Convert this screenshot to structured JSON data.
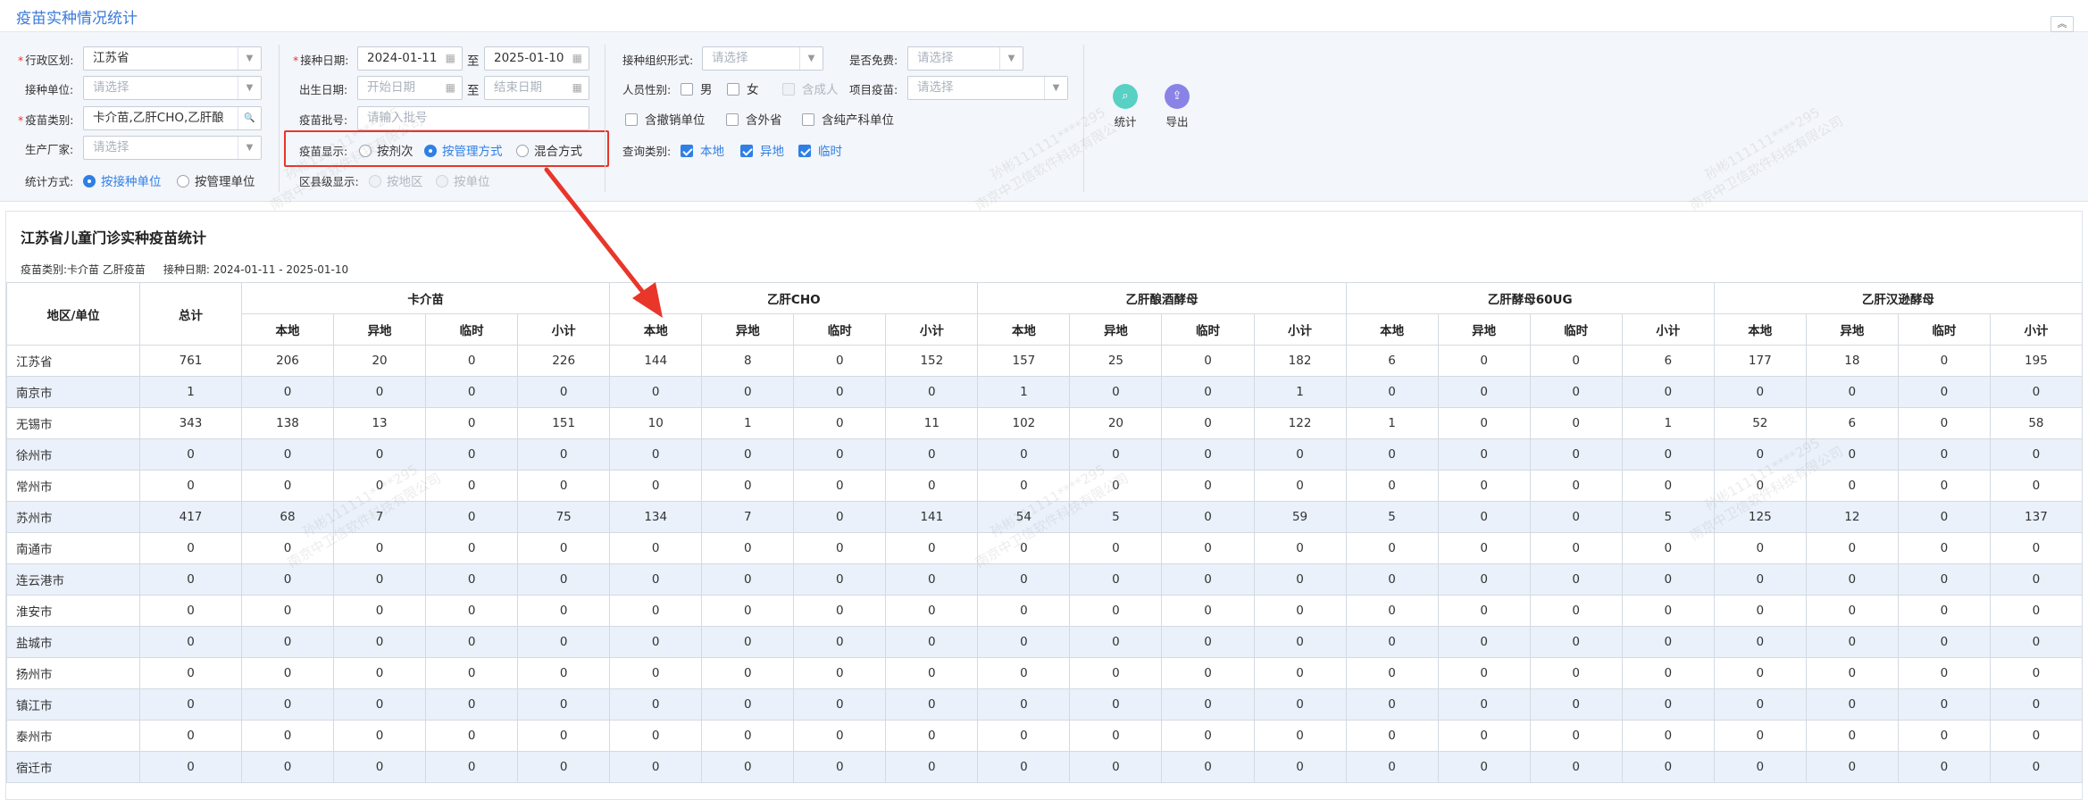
{
  "page": {
    "title": "疫苗实种情况统计",
    "collapse_icon": "double-chevron-up-icon"
  },
  "filters": {
    "region_label": "行政区划:",
    "region_value": "江苏省",
    "unit_label": "接种单位:",
    "unit_placeholder": "请选择",
    "vaccine_type_label": "疫苗类别:",
    "vaccine_type_value": "卡介苗,乙肝CHO,乙肝酿",
    "manufacturer_label": "生产厂家:",
    "manufacturer_placeholder": "请选择",
    "stat_method_label": "统计方式:",
    "stat_method_options": [
      "按接种单位",
      "按管理单位"
    ],
    "vacc_date_label": "接种日期:",
    "vacc_date_from": "2024-01-11",
    "vacc_date_to": "2025-01-10",
    "range_sep": "至",
    "birth_date_label": "出生日期:",
    "birth_date_from_placeholder": "开始日期",
    "birth_date_to_placeholder": "结束日期",
    "batch_label": "疫苗批号:",
    "batch_placeholder": "请输入批号",
    "display_label": "疫苗显示:",
    "display_options": [
      "按剂次",
      "按管理方式",
      "混合方式"
    ],
    "county_label": "区县级显示:",
    "county_options": [
      "按地区",
      "按单位"
    ],
    "org_form_label": "接种组织形式:",
    "org_form_placeholder": "请选择",
    "gender_label": "人员性别:",
    "gender_options": [
      "男",
      "女"
    ],
    "adult_label": "含成人",
    "free_label": "是否免费:",
    "free_placeholder": "请选择",
    "project_label": "项目疫苗:",
    "project_placeholder": "请选择",
    "include_options": [
      "含撤销单位",
      "含外省",
      "含纯产科单位"
    ],
    "query_type_label": "查询类别:",
    "query_type_options": [
      "本地",
      "异地",
      "临时"
    ],
    "stat_button": "统计",
    "export_button": "导出"
  },
  "report": {
    "title": "江苏省儿童门诊实种疫苗统计",
    "sub_vaccine": "疫苗类别:卡介苗 乙肝疫苗",
    "sub_date": "接种日期: 2024-01-11 - 2025-01-10",
    "col_region": "地区/单位",
    "col_total": "总计",
    "vaccines": [
      "卡介苗",
      "乙肝CHO",
      "乙肝酿酒酵母",
      "乙肝酵母60UG",
      "乙肝汉逊酵母"
    ],
    "sub_cols": [
      "本地",
      "异地",
      "临时",
      "小计"
    ],
    "rows": [
      {
        "region": "江苏省",
        "cells": [
          "761",
          "206",
          "20",
          "0",
          "226",
          "144",
          "8",
          "0",
          "152",
          "157",
          "25",
          "0",
          "182",
          "6",
          "0",
          "0",
          "6",
          "177",
          "18",
          "0",
          "195"
        ]
      },
      {
        "region": "南京市",
        "cells": [
          "1",
          "0",
          "0",
          "0",
          "0",
          "0",
          "0",
          "0",
          "0",
          "1",
          "0",
          "0",
          "1",
          "0",
          "0",
          "0",
          "0",
          "0",
          "0",
          "0",
          "0"
        ]
      },
      {
        "region": "无锡市",
        "cells": [
          "343",
          "138",
          "13",
          "0",
          "151",
          "10",
          "1",
          "0",
          "11",
          "102",
          "20",
          "0",
          "122",
          "1",
          "0",
          "0",
          "1",
          "52",
          "6",
          "0",
          "58"
        ]
      },
      {
        "region": "徐州市",
        "cells": [
          "0",
          "0",
          "0",
          "0",
          "0",
          "0",
          "0",
          "0",
          "0",
          "0",
          "0",
          "0",
          "0",
          "0",
          "0",
          "0",
          "0",
          "0",
          "0",
          "0",
          "0"
        ]
      },
      {
        "region": "常州市",
        "cells": [
          "0",
          "0",
          "0",
          "0",
          "0",
          "0",
          "0",
          "0",
          "0",
          "0",
          "0",
          "0",
          "0",
          "0",
          "0",
          "0",
          "0",
          "0",
          "0",
          "0",
          "0"
        ]
      },
      {
        "region": "苏州市",
        "cells": [
          "417",
          "68",
          "7",
          "0",
          "75",
          "134",
          "7",
          "0",
          "141",
          "54",
          "5",
          "0",
          "59",
          "5",
          "0",
          "0",
          "5",
          "125",
          "12",
          "0",
          "137"
        ]
      },
      {
        "region": "南通市",
        "cells": [
          "0",
          "0",
          "0",
          "0",
          "0",
          "0",
          "0",
          "0",
          "0",
          "0",
          "0",
          "0",
          "0",
          "0",
          "0",
          "0",
          "0",
          "0",
          "0",
          "0",
          "0"
        ]
      },
      {
        "region": "连云港市",
        "cells": [
          "0",
          "0",
          "0",
          "0",
          "0",
          "0",
          "0",
          "0",
          "0",
          "0",
          "0",
          "0",
          "0",
          "0",
          "0",
          "0",
          "0",
          "0",
          "0",
          "0",
          "0"
        ]
      },
      {
        "region": "淮安市",
        "cells": [
          "0",
          "0",
          "0",
          "0",
          "0",
          "0",
          "0",
          "0",
          "0",
          "0",
          "0",
          "0",
          "0",
          "0",
          "0",
          "0",
          "0",
          "0",
          "0",
          "0",
          "0"
        ]
      },
      {
        "region": "盐城市",
        "cells": [
          "0",
          "0",
          "0",
          "0",
          "0",
          "0",
          "0",
          "0",
          "0",
          "0",
          "0",
          "0",
          "0",
          "0",
          "0",
          "0",
          "0",
          "0",
          "0",
          "0",
          "0"
        ]
      },
      {
        "region": "扬州市",
        "cells": [
          "0",
          "0",
          "0",
          "0",
          "0",
          "0",
          "0",
          "0",
          "0",
          "0",
          "0",
          "0",
          "0",
          "0",
          "0",
          "0",
          "0",
          "0",
          "0",
          "0",
          "0"
        ]
      },
      {
        "region": "镇江市",
        "cells": [
          "0",
          "0",
          "0",
          "0",
          "0",
          "0",
          "0",
          "0",
          "0",
          "0",
          "0",
          "0",
          "0",
          "0",
          "0",
          "0",
          "0",
          "0",
          "0",
          "0",
          "0"
        ]
      },
      {
        "region": "泰州市",
        "cells": [
          "0",
          "0",
          "0",
          "0",
          "0",
          "0",
          "0",
          "0",
          "0",
          "0",
          "0",
          "0",
          "0",
          "0",
          "0",
          "0",
          "0",
          "0",
          "0",
          "0",
          "0"
        ]
      },
      {
        "region": "宿迁市",
        "cells": [
          "0",
          "0",
          "0",
          "0",
          "0",
          "0",
          "0",
          "0",
          "0",
          "0",
          "0",
          "0",
          "0",
          "0",
          "0",
          "0",
          "0",
          "0",
          "0",
          "0",
          "0"
        ]
      }
    ]
  },
  "watermark": [
    "孙彬111111****295",
    "南京中卫信软件科技有限公司"
  ],
  "colors": {
    "accent": "#2f7fe5",
    "highlight": "#e8362b",
    "row_alt": "#eaf1fb"
  }
}
